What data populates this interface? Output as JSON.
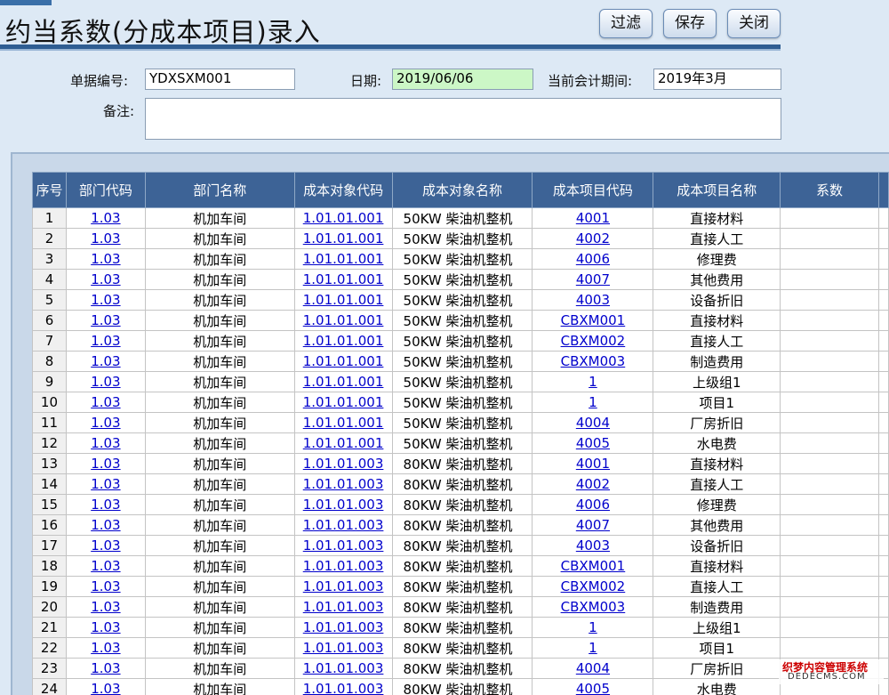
{
  "title": "约当系数(分成本项目)录入",
  "toolbar": {
    "filter": "过滤",
    "save": "保存",
    "close": "关闭"
  },
  "form": {
    "doc_no_label": "单据编号:",
    "doc_no": "YDXSXM001",
    "date_label": "日期:",
    "date": "2019/06/06",
    "period_label": "当前会计期间:",
    "period": "2019年3月",
    "remark_label": "备注:",
    "remark": ""
  },
  "grid": {
    "headers": [
      "序号",
      "部门代码",
      "部门名称",
      "成本对象代码",
      "成本对象名称",
      "成本项目代码",
      "成本项目名称",
      "系数"
    ],
    "rows": [
      [
        "1",
        "1.03",
        "机加车间",
        "1.01.01.001",
        "50KW 柴油机整机",
        "4001",
        "直接材料",
        ""
      ],
      [
        "2",
        "1.03",
        "机加车间",
        "1.01.01.001",
        "50KW 柴油机整机",
        "4002",
        "直接人工",
        ""
      ],
      [
        "3",
        "1.03",
        "机加车间",
        "1.01.01.001",
        "50KW 柴油机整机",
        "4006",
        "修理费",
        ""
      ],
      [
        "4",
        "1.03",
        "机加车间",
        "1.01.01.001",
        "50KW 柴油机整机",
        "4007",
        "其他费用",
        ""
      ],
      [
        "5",
        "1.03",
        "机加车间",
        "1.01.01.001",
        "50KW 柴油机整机",
        "4003",
        "设备折旧",
        ""
      ],
      [
        "6",
        "1.03",
        "机加车间",
        "1.01.01.001",
        "50KW 柴油机整机",
        "CBXM001",
        "直接材料",
        ""
      ],
      [
        "7",
        "1.03",
        "机加车间",
        "1.01.01.001",
        "50KW 柴油机整机",
        "CBXM002",
        "直接人工",
        ""
      ],
      [
        "8",
        "1.03",
        "机加车间",
        "1.01.01.001",
        "50KW 柴油机整机",
        "CBXM003",
        "制造费用",
        ""
      ],
      [
        "9",
        "1.03",
        "机加车间",
        "1.01.01.001",
        "50KW 柴油机整机",
        "1",
        "上级组1",
        ""
      ],
      [
        "10",
        "1.03",
        "机加车间",
        "1.01.01.001",
        "50KW 柴油机整机",
        "1",
        "项目1",
        ""
      ],
      [
        "11",
        "1.03",
        "机加车间",
        "1.01.01.001",
        "50KW 柴油机整机",
        "4004",
        "厂房折旧",
        ""
      ],
      [
        "12",
        "1.03",
        "机加车间",
        "1.01.01.001",
        "50KW 柴油机整机",
        "4005",
        "水电费",
        ""
      ],
      [
        "13",
        "1.03",
        "机加车间",
        "1.01.01.003",
        "80KW 柴油机整机",
        "4001",
        "直接材料",
        ""
      ],
      [
        "14",
        "1.03",
        "机加车间",
        "1.01.01.003",
        "80KW 柴油机整机",
        "4002",
        "直接人工",
        ""
      ],
      [
        "15",
        "1.03",
        "机加车间",
        "1.01.01.003",
        "80KW 柴油机整机",
        "4006",
        "修理费",
        ""
      ],
      [
        "16",
        "1.03",
        "机加车间",
        "1.01.01.003",
        "80KW 柴油机整机",
        "4007",
        "其他费用",
        ""
      ],
      [
        "17",
        "1.03",
        "机加车间",
        "1.01.01.003",
        "80KW 柴油机整机",
        "4003",
        "设备折旧",
        ""
      ],
      [
        "18",
        "1.03",
        "机加车间",
        "1.01.01.003",
        "80KW 柴油机整机",
        "CBXM001",
        "直接材料",
        ""
      ],
      [
        "19",
        "1.03",
        "机加车间",
        "1.01.01.003",
        "80KW 柴油机整机",
        "CBXM002",
        "直接人工",
        ""
      ],
      [
        "20",
        "1.03",
        "机加车间",
        "1.01.01.003",
        "80KW 柴油机整机",
        "CBXM003",
        "制造费用",
        ""
      ],
      [
        "21",
        "1.03",
        "机加车间",
        "1.01.01.003",
        "80KW 柴油机整机",
        "1",
        "上级组1",
        ""
      ],
      [
        "22",
        "1.03",
        "机加车间",
        "1.01.01.003",
        "80KW 柴油机整机",
        "1",
        "项目1",
        ""
      ],
      [
        "23",
        "1.03",
        "机加车间",
        "1.01.01.003",
        "80KW 柴油机整机",
        "4004",
        "厂房折旧",
        ""
      ],
      [
        "24",
        "1.03",
        "机加车间",
        "1.01.01.003",
        "80KW 柴油机整机",
        "4005",
        "水电费",
        ""
      ]
    ]
  },
  "watermark": {
    "line1": "织梦内容管理系统",
    "line2": "DEDECMS.COM"
  },
  "colors": {
    "header_bg": "#3d6396",
    "page_bg": "#dde9f5",
    "link": "#0000cc",
    "date_bg": "#ccf7c6"
  }
}
